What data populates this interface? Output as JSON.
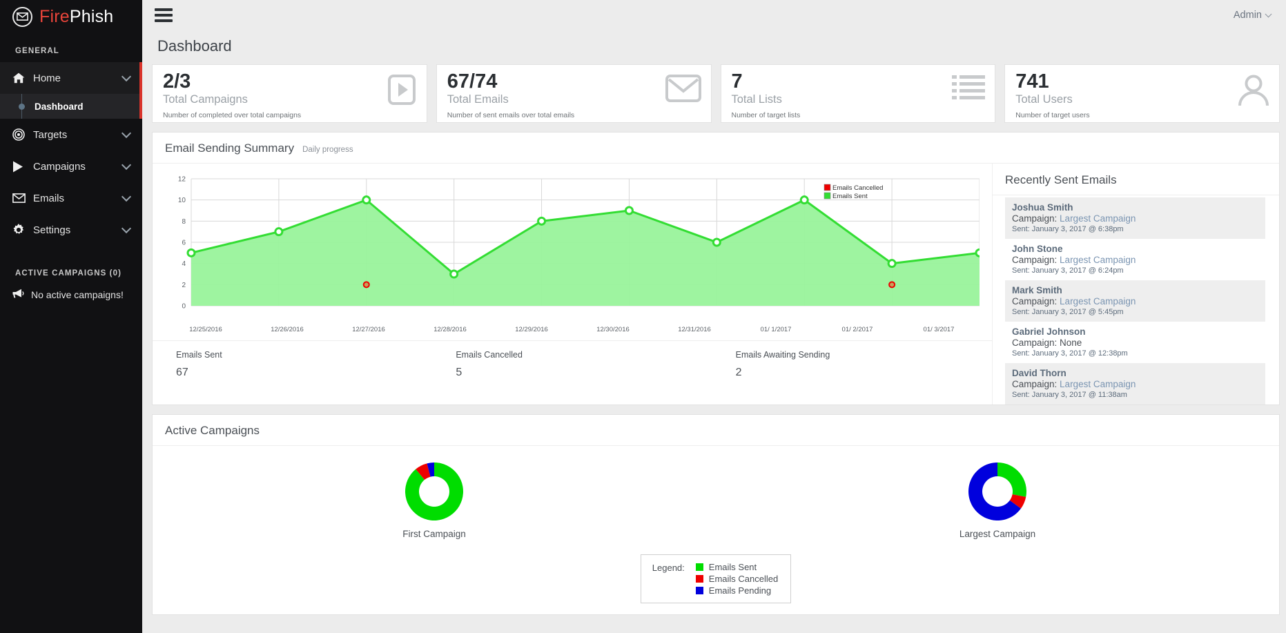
{
  "brand": {
    "fire": "Fire",
    "phish": "Phish",
    "logo_icon": "envelope-circle-icon"
  },
  "sidebar": {
    "section_label": "GENERAL",
    "items": [
      {
        "label": "Home",
        "icon": "home-icon",
        "active": true
      },
      {
        "label": "Targets",
        "icon": "target-icon",
        "active": false
      },
      {
        "label": "Campaigns",
        "icon": "play-icon",
        "active": false
      },
      {
        "label": "Emails",
        "icon": "envelope-icon",
        "active": false
      },
      {
        "label": "Settings",
        "icon": "gear-icon",
        "active": false
      }
    ],
    "sub_item": {
      "label": "Dashboard"
    },
    "active_campaigns_label": "ACTIVE CAMPAIGNS (0)",
    "no_active": "No active campaigns!",
    "megaphone_icon": "megaphone-icon"
  },
  "topbar": {
    "menu_icon": "hamburger-menu-icon",
    "admin_label": "Admin",
    "admin_chevron_icon": "chevron-down-icon"
  },
  "page": {
    "title": "Dashboard"
  },
  "cards": [
    {
      "value": "2/3",
      "title": "Total Campaigns",
      "sub": "Number of completed over total campaigns",
      "icon": "play-square-icon"
    },
    {
      "value": "67/74",
      "title": "Total Emails",
      "sub": "Number of sent emails over total emails",
      "icon": "envelope-icon"
    },
    {
      "value": "7",
      "title": "Total Lists",
      "sub": "Number of target lists",
      "icon": "list-icon"
    },
    {
      "value": "741",
      "title": "Total Users",
      "sub": "Number of target users",
      "icon": "user-icon"
    }
  ],
  "summary_panel": {
    "title": "Email Sending Summary",
    "subtitle": "Daily progress",
    "stats": [
      {
        "label": "Emails Sent",
        "value": "67"
      },
      {
        "label": "Emails Cancelled",
        "value": "5"
      },
      {
        "label": "Emails Awaiting Sending",
        "value": "2"
      }
    ]
  },
  "recently_sent": {
    "title": "Recently Sent Emails",
    "campaign_prefix": "Campaign: ",
    "sent_prefix": "Sent: ",
    "items": [
      {
        "name": "Joshua Smith",
        "campaign": "Largest Campaign",
        "sent": "January 3, 2017 @ 6:38pm"
      },
      {
        "name": "John Stone",
        "campaign": "Largest Campaign",
        "sent": "January 3, 2017 @ 6:24pm"
      },
      {
        "name": "Mark Smith",
        "campaign": "Largest Campaign",
        "sent": "January 3, 2017 @ 5:45pm"
      },
      {
        "name": "Gabriel Johnson",
        "campaign": "None",
        "sent": "January 3, 2017 @ 12:38pm"
      },
      {
        "name": "David Thorn",
        "campaign": "Largest Campaign",
        "sent": "January 3, 2017 @ 11:38am"
      }
    ]
  },
  "active_campaigns_panel": {
    "title": "Active Campaigns",
    "legend_title": "Legend:",
    "legend": [
      {
        "label": "Emails Sent",
        "color": "#00dd00"
      },
      {
        "label": "Emails Cancelled",
        "color": "#ee0000"
      },
      {
        "label": "Emails Pending",
        "color": "#0000dd"
      }
    ]
  },
  "colors": {
    "sent_green": "#33dd33",
    "green_fill": "#99f39b",
    "cancelled_red": "#ee0000",
    "pending_blue": "#0000dd",
    "accent_red": "#d9342b"
  },
  "chart_data": [
    {
      "type": "area",
      "title": "Email Sending Summary",
      "subtitle": "Daily progress",
      "xlabel": "",
      "ylabel": "",
      "ylim": [
        0,
        12
      ],
      "yticks": [
        0,
        2,
        4,
        6,
        8,
        10,
        12
      ],
      "grid": true,
      "legend_position": "top-right",
      "categories": [
        "12/25/2016",
        "12/26/2016",
        "12/27/2016",
        "12/28/2016",
        "12/29/2016",
        "12/30/2016",
        "12/31/2016",
        "01/ 1/2017",
        "01/ 2/2017",
        "01/ 3/2017"
      ],
      "series": [
        {
          "name": "Emails Sent",
          "color": "#33dd33",
          "values": [
            5,
            7,
            10,
            3,
            8,
            9,
            6,
            10,
            4,
            5
          ]
        },
        {
          "name": "Emails Cancelled",
          "color": "#ee0000",
          "values": [
            null,
            null,
            2,
            null,
            null,
            null,
            null,
            null,
            2,
            null
          ]
        }
      ]
    },
    {
      "type": "pie",
      "title": "First Campaign",
      "labels": [
        "Emails Sent",
        "Emails Cancelled",
        "Emails Pending"
      ],
      "values": [
        89,
        7,
        4
      ],
      "colors": [
        "#00dd00",
        "#ee0000",
        "#0000dd"
      ],
      "donut": true
    },
    {
      "type": "pie",
      "title": "Largest Campaign",
      "labels": [
        "Emails Sent",
        "Emails Cancelled",
        "Emails Pending"
      ],
      "values": [
        28,
        7,
        65
      ],
      "colors": [
        "#00dd00",
        "#ee0000",
        "#0000dd"
      ],
      "donut": true
    }
  ]
}
